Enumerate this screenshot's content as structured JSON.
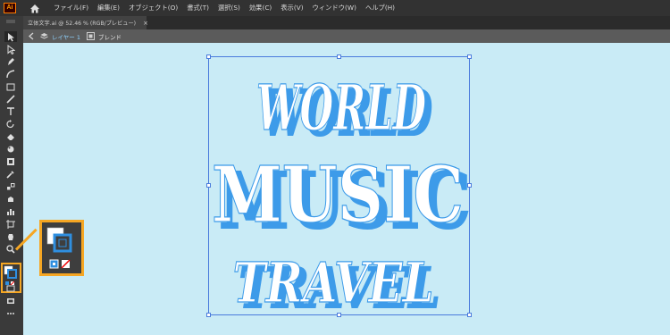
{
  "app": {
    "logo_text": "Ai"
  },
  "menu": [
    "ファイル(F)",
    "編集(E)",
    "オブジェクト(O)",
    "書式(T)",
    "選択(S)",
    "効果(C)",
    "表示(V)",
    "ウィンドウ(W)",
    "ヘルプ(H)"
  ],
  "tab": {
    "title": "立体文字.ai @ 52.46 % (RGB/プレビュー)",
    "close": "×"
  },
  "breadcrumb": {
    "layer": "レイヤー 1",
    "blend": "ブレンド"
  },
  "artwork": {
    "lines": [
      "WORLD",
      "MUSIC",
      "TRAVEL"
    ]
  },
  "colors": {
    "canvas_bg": "#c9ebf6",
    "text_face": "#ffffff",
    "text_extrude": "#3d9be9",
    "highlight": "#f5a623",
    "selection": "#4a7bdc"
  },
  "icons": [
    "home-icon",
    "selection-tool-icon",
    "direct-selection-tool-icon",
    "pen-tool-icon",
    "curvature-tool-icon",
    "rectangle-tool-icon",
    "paintbrush-tool-icon",
    "type-tool-icon",
    "rotate-tool-icon",
    "eraser-tool-icon",
    "warp-tool-icon",
    "width-tool-icon",
    "eyedropper-tool-icon",
    "blend-tool-icon",
    "symbol-sprayer-icon",
    "artboard-tool-icon",
    "graph-tool-icon",
    "hand-tool-icon",
    "zoom-tool-icon",
    "fill-stroke-icon",
    "draw-mode-icon",
    "screen-mode-icon",
    "more-tools-icon"
  ]
}
